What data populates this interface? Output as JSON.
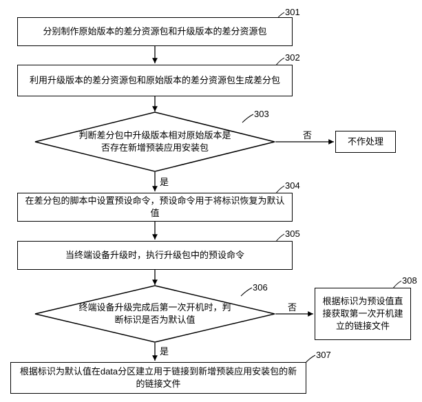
{
  "chart_data": {
    "type": "flowchart",
    "nodes": [
      {
        "id": "301",
        "type": "process",
        "text": "分别制作原始版本的差分资源包和升级版本的差分资源包"
      },
      {
        "id": "302",
        "type": "process",
        "text": "利用升级版本的差分资源包和原始版本的差分资源包生成差分包"
      },
      {
        "id": "303",
        "type": "decision",
        "text": "判断差分包中升级版本相对原始版本是否存在新增预装应用安装包"
      },
      {
        "id": "303b",
        "type": "process",
        "text": "不作处理"
      },
      {
        "id": "304",
        "type": "process",
        "text": "在差分包的脚本中设置预设命令，预设命令用于将标识恢复为默认值"
      },
      {
        "id": "305",
        "type": "process",
        "text": "当终端设备升级时，执行升级包中的预设命令"
      },
      {
        "id": "306",
        "type": "decision",
        "text": "终端设备升级完成后第一次开机时，判断标识是否为默认值"
      },
      {
        "id": "308",
        "type": "process",
        "text": "根据标识为预设值直接获取第一次开机建立的链接文件"
      },
      {
        "id": "307",
        "type": "process",
        "text": "根据标识为默认值在data分区建立用于链接到新增预装应用安装包的新的链接文件"
      }
    ],
    "edges": [
      {
        "from": "301",
        "to": "302"
      },
      {
        "from": "302",
        "to": "303"
      },
      {
        "from": "303",
        "to": "303b",
        "label": "否"
      },
      {
        "from": "303",
        "to": "304",
        "label": "是"
      },
      {
        "from": "304",
        "to": "305"
      },
      {
        "from": "305",
        "to": "306"
      },
      {
        "from": "306",
        "to": "308",
        "label": "否"
      },
      {
        "from": "306",
        "to": "307",
        "label": "是"
      }
    ]
  },
  "labels": {
    "yes": "是",
    "no": "否",
    "n301": "301",
    "n302": "302",
    "n303": "303",
    "n304": "304",
    "n305": "305",
    "n306": "306",
    "n307": "307",
    "n308": "308"
  },
  "text": {
    "s301": "分别制作原始版本的差分资源包和升级版本的差分资源包",
    "s302": "利用升级版本的差分资源包和原始版本的差分资源包生成差分包",
    "s303": "判断差分包中升级版本相对原始版本是否存在新增预装应用安装包",
    "s303b": "不作处理",
    "s304": "在差分包的脚本中设置预设命令，预设命令用于将标识恢复为默认值",
    "s305": "当终端设备升级时，执行升级包中的预设命令",
    "s306": "终端设备升级完成后第一次开机时，判断标识是否为默认值",
    "s307": "根据标识为默认值在data分区建立用于链接到新增预装应用安装包的新的链接文件",
    "s308": "根据标识为预设值直接获取第一次开机建立的链接文件"
  }
}
